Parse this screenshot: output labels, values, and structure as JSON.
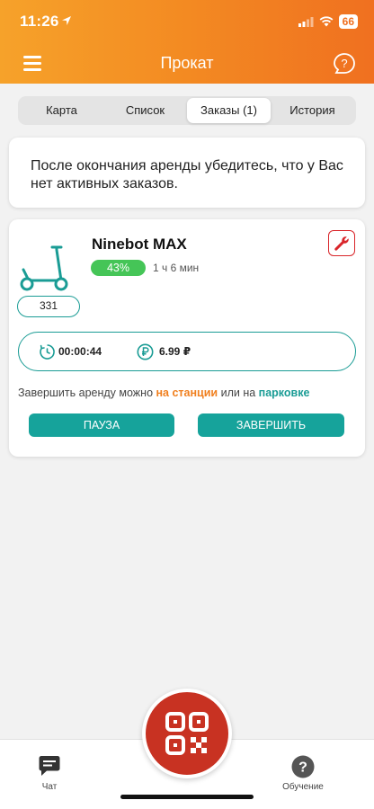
{
  "status_bar": {
    "time": "11:26",
    "battery": "66"
  },
  "header": {
    "title": "Прокат",
    "menu_icon": "hamburger-icon",
    "help_icon": "question-bubble-icon"
  },
  "tabs": [
    {
      "label": "Карта",
      "active": false
    },
    {
      "label": "Список",
      "active": false
    },
    {
      "label": "Заказы (1)",
      "active": true
    },
    {
      "label": "История",
      "active": false
    }
  ],
  "notice": "После окончания аренды убедитесь, что у Вас нет активных заказов.",
  "order": {
    "model": "Ninebot MAX",
    "scooter_id": "331",
    "battery_level": "43%",
    "range": "1 ч 6 мин",
    "timer": "00:00:44",
    "price": "6.99 ₽",
    "end_note_prefix": "Завершить аренду можно ",
    "end_note_station": "на станции",
    "end_note_middle": " или на ",
    "end_note_parking": "парковке",
    "pause_label": "ПАУЗА",
    "finish_label": "ЗАВЕРШИТЬ"
  },
  "bottom_nav": {
    "chat_label": "Чат",
    "learn_label": "Обучение",
    "qr_icon": "qr-code-icon"
  },
  "colors": {
    "accent_orange": "#f38a22",
    "teal": "#16a39b",
    "qr_red": "#c83222",
    "battery_green": "#45c557",
    "wrench_red": "#d9252a"
  }
}
